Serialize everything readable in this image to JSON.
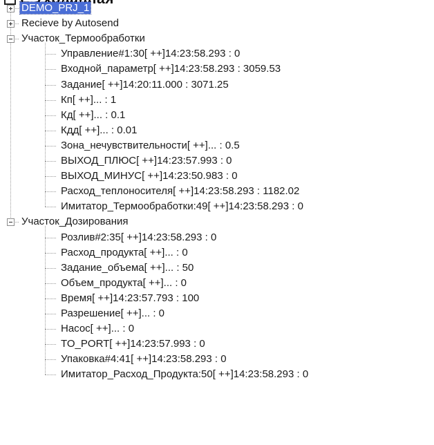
{
  "cut_title": "Е Уходанная",
  "tree": {
    "roots": [
      {
        "label": "DEMO_PRJ_1",
        "state": "collapsed",
        "selected": true
      },
      {
        "label": "Recieve by Autosend",
        "state": "collapsed",
        "selected": false
      },
      {
        "label": "Участок_Термообработки",
        "state": "expanded",
        "children": [
          {
            "label": "Управление#1:30[ ++]14:23:58.293 : 0"
          },
          {
            "label": "Входной_параметр[ ++]14:23:58.293 : 3059.53"
          },
          {
            "label": "Задание[ ++]14:20:11.000 : 3071.25"
          },
          {
            "label": "Кп[ ++]... : 1"
          },
          {
            "label": "Кд[ ++]... : 0.1"
          },
          {
            "label": "Кдд[ ++]... : 0.01"
          },
          {
            "label": "Зона_нечувствительности[ ++]... : 0.5"
          },
          {
            "label": "ВЫХОД_ПЛЮС[ ++]14:23:57.993 : 0"
          },
          {
            "label": "ВЫХОД_МИНУС[ ++]14:23:50.983 : 0"
          },
          {
            "label": "Расход_теплоносителя[ ++]14:23:58.293 : 1182.02"
          },
          {
            "label": "Имитатор_Термообработки:49[ ++]14:23:58.293 : 0"
          }
        ]
      },
      {
        "label": "Участок_Дозирования",
        "state": "expanded",
        "children": [
          {
            "label": "Розлив#2:35[ ++]14:23:58.293 : 0"
          },
          {
            "label": "Расход_продукта[ ++]... : 0"
          },
          {
            "label": "Задание_объема[ ++]... : 50"
          },
          {
            "label": "Объем_продукта[ ++]... : 0"
          },
          {
            "label": "Время[ ++]14:23:57.793 : 100"
          },
          {
            "label": "Разрешение[ ++]... : 0"
          },
          {
            "label": "Насос[ ++]... : 0"
          },
          {
            "label": "TO_PORT[ ++]14:23:57.993 : 0"
          },
          {
            "label": "Упаковка#4:41[ ++]14:23:58.293 : 0"
          },
          {
            "label": "Имитатор_Расход_Продукта:50[ ++]14:23:58.293 : 0"
          }
        ]
      }
    ]
  }
}
